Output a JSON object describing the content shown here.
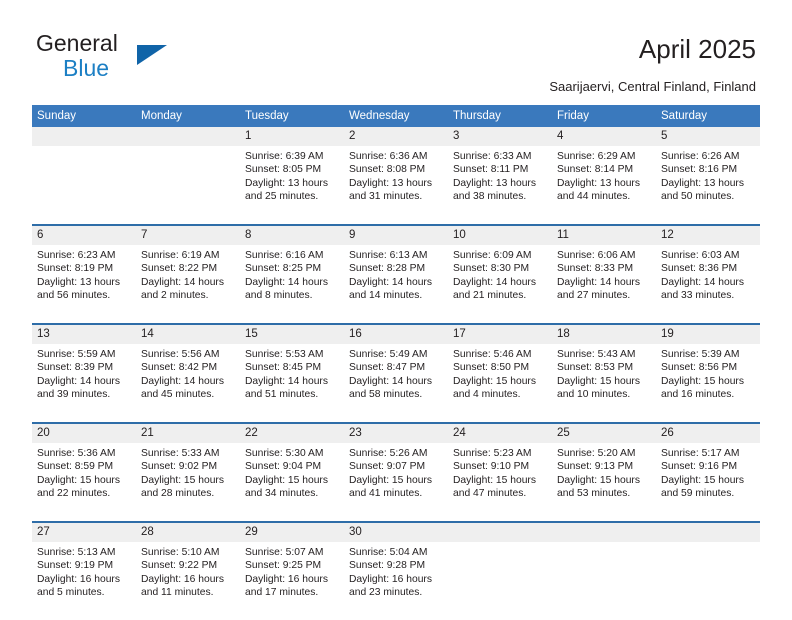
{
  "brand": {
    "line1": "General",
    "line2": "Blue",
    "triangle_color": "#1064a8",
    "blue_text_color": "#1c7fc4"
  },
  "header": {
    "title": "April 2025",
    "subtitle": "Saarijaervi, Central Finland, Finland"
  },
  "theme": {
    "header_bg": "#3a79bd",
    "week_rule": "#2e6da8",
    "daynum_bg": "#efefef",
    "text": "#231f20"
  },
  "calendar": {
    "weekday_headers": [
      "Sunday",
      "Monday",
      "Tuesday",
      "Wednesday",
      "Thursday",
      "Friday",
      "Saturday"
    ],
    "weeks": [
      [
        {
          "day": "",
          "sunrise": "",
          "sunset": "",
          "daylight1": "",
          "daylight2": ""
        },
        {
          "day": "",
          "sunrise": "",
          "sunset": "",
          "daylight1": "",
          "daylight2": ""
        },
        {
          "day": "1",
          "sunrise": "Sunrise: 6:39 AM",
          "sunset": "Sunset: 8:05 PM",
          "daylight1": "Daylight: 13 hours",
          "daylight2": "and 25 minutes."
        },
        {
          "day": "2",
          "sunrise": "Sunrise: 6:36 AM",
          "sunset": "Sunset: 8:08 PM",
          "daylight1": "Daylight: 13 hours",
          "daylight2": "and 31 minutes."
        },
        {
          "day": "3",
          "sunrise": "Sunrise: 6:33 AM",
          "sunset": "Sunset: 8:11 PM",
          "daylight1": "Daylight: 13 hours",
          "daylight2": "and 38 minutes."
        },
        {
          "day": "4",
          "sunrise": "Sunrise: 6:29 AM",
          "sunset": "Sunset: 8:14 PM",
          "daylight1": "Daylight: 13 hours",
          "daylight2": "and 44 minutes."
        },
        {
          "day": "5",
          "sunrise": "Sunrise: 6:26 AM",
          "sunset": "Sunset: 8:16 PM",
          "daylight1": "Daylight: 13 hours",
          "daylight2": "and 50 minutes."
        }
      ],
      [
        {
          "day": "6",
          "sunrise": "Sunrise: 6:23 AM",
          "sunset": "Sunset: 8:19 PM",
          "daylight1": "Daylight: 13 hours",
          "daylight2": "and 56 minutes."
        },
        {
          "day": "7",
          "sunrise": "Sunrise: 6:19 AM",
          "sunset": "Sunset: 8:22 PM",
          "daylight1": "Daylight: 14 hours",
          "daylight2": "and 2 minutes."
        },
        {
          "day": "8",
          "sunrise": "Sunrise: 6:16 AM",
          "sunset": "Sunset: 8:25 PM",
          "daylight1": "Daylight: 14 hours",
          "daylight2": "and 8 minutes."
        },
        {
          "day": "9",
          "sunrise": "Sunrise: 6:13 AM",
          "sunset": "Sunset: 8:28 PM",
          "daylight1": "Daylight: 14 hours",
          "daylight2": "and 14 minutes."
        },
        {
          "day": "10",
          "sunrise": "Sunrise: 6:09 AM",
          "sunset": "Sunset: 8:30 PM",
          "daylight1": "Daylight: 14 hours",
          "daylight2": "and 21 minutes."
        },
        {
          "day": "11",
          "sunrise": "Sunrise: 6:06 AM",
          "sunset": "Sunset: 8:33 PM",
          "daylight1": "Daylight: 14 hours",
          "daylight2": "and 27 minutes."
        },
        {
          "day": "12",
          "sunrise": "Sunrise: 6:03 AM",
          "sunset": "Sunset: 8:36 PM",
          "daylight1": "Daylight: 14 hours",
          "daylight2": "and 33 minutes."
        }
      ],
      [
        {
          "day": "13",
          "sunrise": "Sunrise: 5:59 AM",
          "sunset": "Sunset: 8:39 PM",
          "daylight1": "Daylight: 14 hours",
          "daylight2": "and 39 minutes."
        },
        {
          "day": "14",
          "sunrise": "Sunrise: 5:56 AM",
          "sunset": "Sunset: 8:42 PM",
          "daylight1": "Daylight: 14 hours",
          "daylight2": "and 45 minutes."
        },
        {
          "day": "15",
          "sunrise": "Sunrise: 5:53 AM",
          "sunset": "Sunset: 8:45 PM",
          "daylight1": "Daylight: 14 hours",
          "daylight2": "and 51 minutes."
        },
        {
          "day": "16",
          "sunrise": "Sunrise: 5:49 AM",
          "sunset": "Sunset: 8:47 PM",
          "daylight1": "Daylight: 14 hours",
          "daylight2": "and 58 minutes."
        },
        {
          "day": "17",
          "sunrise": "Sunrise: 5:46 AM",
          "sunset": "Sunset: 8:50 PM",
          "daylight1": "Daylight: 15 hours",
          "daylight2": "and 4 minutes."
        },
        {
          "day": "18",
          "sunrise": "Sunrise: 5:43 AM",
          "sunset": "Sunset: 8:53 PM",
          "daylight1": "Daylight: 15 hours",
          "daylight2": "and 10 minutes."
        },
        {
          "day": "19",
          "sunrise": "Sunrise: 5:39 AM",
          "sunset": "Sunset: 8:56 PM",
          "daylight1": "Daylight: 15 hours",
          "daylight2": "and 16 minutes."
        }
      ],
      [
        {
          "day": "20",
          "sunrise": "Sunrise: 5:36 AM",
          "sunset": "Sunset: 8:59 PM",
          "daylight1": "Daylight: 15 hours",
          "daylight2": "and 22 minutes."
        },
        {
          "day": "21",
          "sunrise": "Sunrise: 5:33 AM",
          "sunset": "Sunset: 9:02 PM",
          "daylight1": "Daylight: 15 hours",
          "daylight2": "and 28 minutes."
        },
        {
          "day": "22",
          "sunrise": "Sunrise: 5:30 AM",
          "sunset": "Sunset: 9:04 PM",
          "daylight1": "Daylight: 15 hours",
          "daylight2": "and 34 minutes."
        },
        {
          "day": "23",
          "sunrise": "Sunrise: 5:26 AM",
          "sunset": "Sunset: 9:07 PM",
          "daylight1": "Daylight: 15 hours",
          "daylight2": "and 41 minutes."
        },
        {
          "day": "24",
          "sunrise": "Sunrise: 5:23 AM",
          "sunset": "Sunset: 9:10 PM",
          "daylight1": "Daylight: 15 hours",
          "daylight2": "and 47 minutes."
        },
        {
          "day": "25",
          "sunrise": "Sunrise: 5:20 AM",
          "sunset": "Sunset: 9:13 PM",
          "daylight1": "Daylight: 15 hours",
          "daylight2": "and 53 minutes."
        },
        {
          "day": "26",
          "sunrise": "Sunrise: 5:17 AM",
          "sunset": "Sunset: 9:16 PM",
          "daylight1": "Daylight: 15 hours",
          "daylight2": "and 59 minutes."
        }
      ],
      [
        {
          "day": "27",
          "sunrise": "Sunrise: 5:13 AM",
          "sunset": "Sunset: 9:19 PM",
          "daylight1": "Daylight: 16 hours",
          "daylight2": "and 5 minutes."
        },
        {
          "day": "28",
          "sunrise": "Sunrise: 5:10 AM",
          "sunset": "Sunset: 9:22 PM",
          "daylight1": "Daylight: 16 hours",
          "daylight2": "and 11 minutes."
        },
        {
          "day": "29",
          "sunrise": "Sunrise: 5:07 AM",
          "sunset": "Sunset: 9:25 PM",
          "daylight1": "Daylight: 16 hours",
          "daylight2": "and 17 minutes."
        },
        {
          "day": "30",
          "sunrise": "Sunrise: 5:04 AM",
          "sunset": "Sunset: 9:28 PM",
          "daylight1": "Daylight: 16 hours",
          "daylight2": "and 23 minutes."
        },
        {
          "day": "",
          "sunrise": "",
          "sunset": "",
          "daylight1": "",
          "daylight2": ""
        },
        {
          "day": "",
          "sunrise": "",
          "sunset": "",
          "daylight1": "",
          "daylight2": ""
        },
        {
          "day": "",
          "sunrise": "",
          "sunset": "",
          "daylight1": "",
          "daylight2": ""
        }
      ]
    ]
  }
}
